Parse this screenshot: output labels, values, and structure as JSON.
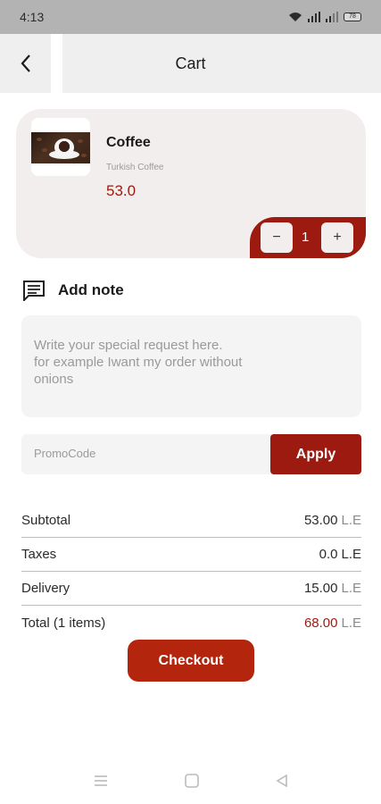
{
  "status_bar": {
    "time": "4:13",
    "battery": "78"
  },
  "header": {
    "title": "Cart"
  },
  "cart_item": {
    "name": "Coffee",
    "description": "Turkish Coffee",
    "price": "53.0",
    "quantity": "1",
    "minus_label": "−",
    "plus_label": "+"
  },
  "note": {
    "label": "Add note",
    "placeholder": "Write your special request here.\nfor example Iwant my order without\n onions"
  },
  "promo": {
    "placeholder": "PromoCode",
    "apply_label": "Apply"
  },
  "summary": {
    "rows": [
      {
        "label": "Subtotal",
        "value": "53.00",
        "unit": "L.E"
      },
      {
        "label": "Taxes",
        "value": "0.0",
        "unit": "L.E"
      },
      {
        "label": "Delivery",
        "value": "15.00",
        "unit": "L.E"
      },
      {
        "label": "Total (1 items)",
        "value": "68.00",
        "unit": "L.E"
      }
    ]
  },
  "checkout_label": "Checkout",
  "colors": {
    "accent": "#9c1a10",
    "checkout": "#b3250d",
    "card_bg": "#f3eeee"
  },
  "icons": {
    "back": "chevron-left-icon",
    "note": "message-note-icon"
  }
}
